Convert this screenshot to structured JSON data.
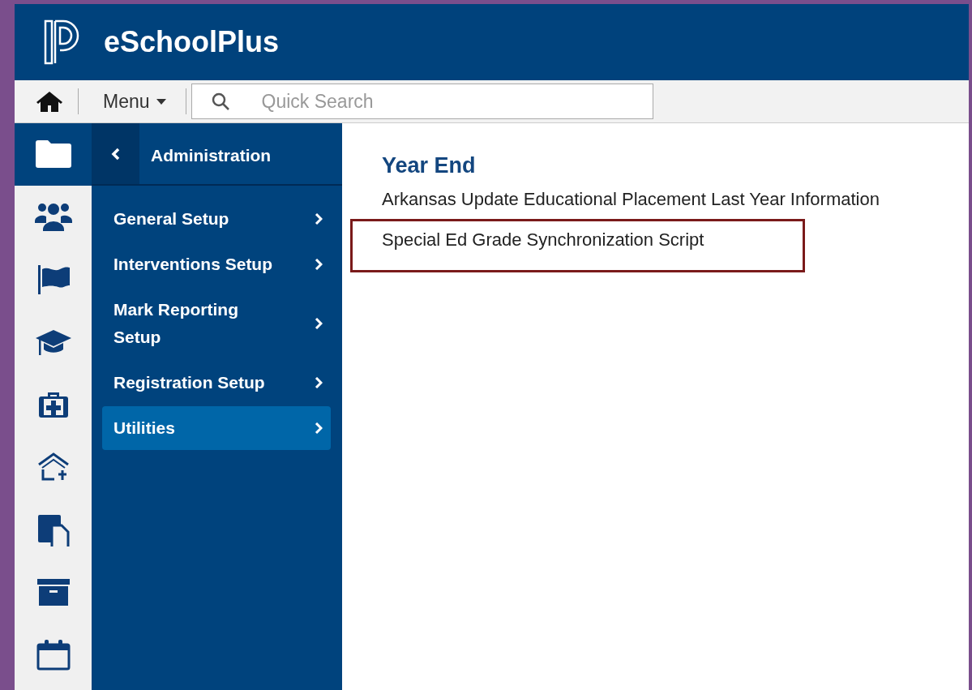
{
  "header": {
    "app_name": "eSchoolPlus"
  },
  "toolbar": {
    "menu_label": "Menu",
    "search": {
      "placeholder": "Quick Search"
    }
  },
  "rail": [
    {
      "selected": true
    },
    {
      "selected": false
    },
    {
      "selected": false
    },
    {
      "selected": false
    },
    {
      "selected": false
    },
    {
      "selected": false
    },
    {
      "selected": false
    },
    {
      "selected": false
    },
    {
      "selected": false
    }
  ],
  "menu": {
    "title": "Administration",
    "items": [
      {
        "label": "General Setup",
        "selected": false
      },
      {
        "label": "Interventions Setup",
        "selected": false
      },
      {
        "label": "Mark Reporting Setup",
        "selected": false
      },
      {
        "label": "Registration Setup",
        "selected": false
      },
      {
        "label": "Utilities",
        "selected": true
      }
    ]
  },
  "content": {
    "heading": "Year End",
    "links": [
      {
        "label": "Arkansas Update Educational Placement Last Year Information",
        "highlighted": false
      },
      {
        "label": "Special Ed Grade Synchronization Script",
        "highlighted": true
      }
    ]
  }
}
